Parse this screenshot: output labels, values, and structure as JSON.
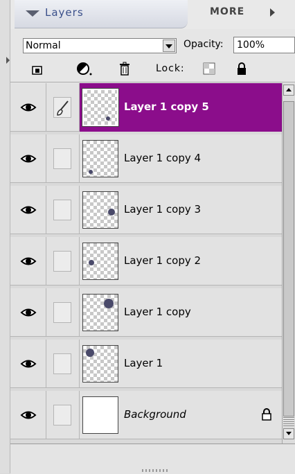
{
  "panel": {
    "tab_title": "Layers",
    "more_label": "MORE"
  },
  "controls": {
    "blend_mode": "Normal",
    "opacity_label": "Opacity:",
    "opacity_value": "100%",
    "lock_label": "Lock:"
  },
  "layers": [
    {
      "name": "Layer 1 copy 5",
      "selected": true
    },
    {
      "name": "Layer 1 copy 4",
      "selected": false
    },
    {
      "name": "Layer 1 copy 3",
      "selected": false
    },
    {
      "name": "Layer 1 copy 2",
      "selected": false
    },
    {
      "name": "Layer 1 copy",
      "selected": false
    },
    {
      "name": "Layer 1",
      "selected": false
    },
    {
      "name": "Background",
      "selected": false,
      "locked": true
    }
  ],
  "colors": {
    "selection": "#8b0d8b",
    "tab_title": "#3a4f8a"
  },
  "icons": [
    "eye-icon",
    "brush-icon",
    "lock-icon",
    "trash-icon",
    "new-layer-icon",
    "adjustment-icon"
  ]
}
